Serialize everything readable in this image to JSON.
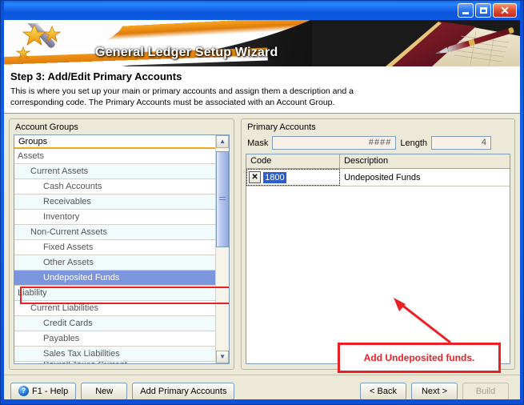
{
  "window": {
    "titlebar_buttons": [
      {
        "name": "minimize-button",
        "glyph": "_"
      },
      {
        "name": "maximize-button",
        "glyph": "□"
      },
      {
        "name": "close-button",
        "glyph": "✕"
      }
    ]
  },
  "banner": {
    "title": "General Ledger Setup Wizard",
    "wand_icon": "magic-wand-icon",
    "photo_alt": "ledger-books-and-pen-photo"
  },
  "step": {
    "title": "Step 3: Add/Edit Primary Accounts",
    "description": "This is where you set up your main or primary accounts and assign them a description and a corresponding code. The Primary Accounts must be associated with an Account Group."
  },
  "left_pane": {
    "label": "Account Groups",
    "column_header": "Groups",
    "rows": [
      {
        "label": "Assets",
        "level": 0
      },
      {
        "label": "Current Assets",
        "level": 1
      },
      {
        "label": "Cash Accounts",
        "level": 2
      },
      {
        "label": "Receivables",
        "level": 2
      },
      {
        "label": "Inventory",
        "level": 2
      },
      {
        "label": "Non-Current Assets",
        "level": 1
      },
      {
        "label": "Fixed Assets",
        "level": 2
      },
      {
        "label": "Other Assets",
        "level": 2
      },
      {
        "label": "Undeposited Funds",
        "level": 2
      },
      {
        "label": "Liability",
        "level": 0
      },
      {
        "label": "Current Liabilities",
        "level": 1
      },
      {
        "label": "Credit Cards",
        "level": 2
      },
      {
        "label": "Payables",
        "level": 2
      },
      {
        "label": "Sales Tax Liabilities",
        "level": 2
      },
      {
        "label": "Payroll Taxes Current",
        "level": 2
      }
    ],
    "selected_row": "Undeposited Funds",
    "scroll_up_glyph": "▲",
    "scroll_down_glyph": "▼"
  },
  "right_pane": {
    "label": "Primary Accounts",
    "mask_label": "Mask",
    "mask_value": "####",
    "length_label": "Length",
    "length_value": "4",
    "grid": {
      "columns": [
        "Code",
        "Description"
      ],
      "rows": [
        {
          "delete_glyph": "✕",
          "code": "1800",
          "description": "Undeposited Funds"
        }
      ]
    }
  },
  "annotation": {
    "callout_text": "Add Undeposited funds.",
    "color": "#ec2024"
  },
  "footer": {
    "help_label": "F1 - Help",
    "help_icon_glyph": "?",
    "new_label": "New",
    "add_primary_label": "Add Primary Accounts",
    "back_label": "< Back",
    "next_label": "Next >",
    "build_label": "Build"
  }
}
